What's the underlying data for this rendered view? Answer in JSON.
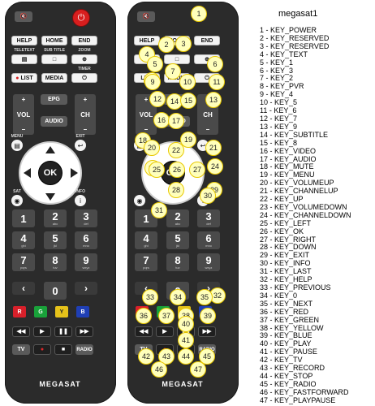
{
  "remote_labels": {
    "help": "HELP",
    "home": "HOME",
    "end": "END",
    "teletext": "TELETEXT",
    "subtitle": "SUB TITLE",
    "zoom": "ZOOM",
    "list": "LIST",
    "media": "MEDIA",
    "timer": "TIMER",
    "vol": "VOL",
    "ch": "CH",
    "epg": "EPG",
    "audio": "AUDIO",
    "menu": "MENU",
    "exit": "EXIT",
    "ok": "OK",
    "sat": "SAT",
    "info": "INFO",
    "tv": "TV",
    "radio": "RADIO",
    "brand": "MEGASAT",
    "plus": "+",
    "minus": "–"
  },
  "number_keys": [
    {
      "digit": "1",
      "letters": ""
    },
    {
      "digit": "2",
      "letters": "abc"
    },
    {
      "digit": "3",
      "letters": "def"
    },
    {
      "digit": "4",
      "letters": "ghi"
    },
    {
      "digit": "5",
      "letters": "jkl"
    },
    {
      "digit": "6",
      "letters": "mno"
    },
    {
      "digit": "7",
      "letters": "pqrs"
    },
    {
      "digit": "8",
      "letters": "tuv"
    },
    {
      "digit": "9",
      "letters": "wxyz"
    },
    {
      "digit": "0",
      "letters": ""
    }
  ],
  "color_keys": [
    {
      "letter": "R",
      "color": "#d8202a"
    },
    {
      "letter": "G",
      "color": "#19a23a"
    },
    {
      "letter": "Y",
      "color": "#e6c21a"
    },
    {
      "letter": "B",
      "color": "#1f3fb5"
    }
  ],
  "marker_numbers": [
    "1",
    "2",
    "3",
    "4",
    "5",
    "6",
    "7",
    "8",
    "9",
    "10",
    "11",
    "12",
    "13",
    "14",
    "15",
    "16",
    "17",
    "18",
    "19",
    "20",
    "21",
    "22",
    "23",
    "24",
    "25",
    "26",
    "27",
    "28",
    "29",
    "30",
    "31",
    "32",
    "33",
    "34",
    "35",
    "36",
    "37",
    "38",
    "39",
    "40",
    "41",
    "42",
    "43",
    "44",
    "45",
    "46",
    "47"
  ],
  "legend": {
    "title": "megasat1",
    "items": [
      "1 - KEY_POWER",
      "2 - KEY_RESERVED",
      "3 - KEY_RESERVED",
      "4 - KEY_TEXT",
      "5 - KEY_1",
      "6 - KEY_3",
      "7 - KEY_2",
      "8 - KEY_PVR",
      "9 - KEY_4",
      "10 - KEY_5",
      "11 - KEY_6",
      "12 - KEY_7",
      "13 - KEY_9",
      "14 - KEY_SUBTITLE",
      "15 - KEY_8",
      "16 - KEY_VIDEO",
      "17 - KEY_AUDIO",
      "18 - KEY_MUTE",
      "19 - KEY_MENU",
      "20 - KEY_VOLUMEUP",
      "21 - KEY_CHANNELUP",
      "22 - KEY_UP",
      "23 - KEY_VOLUMEDOWN",
      "24 - KEY_CHANNELDOWN",
      "25 - KEY_LEFT",
      "26 - KEY_OK",
      "27 - KEY_RIGHT",
      "28 - KEY_DOWN",
      "29 - KEY_EXIT",
      "30 - KEY_INFO",
      "31 - KEY_LAST",
      "32 - KEY_HELP",
      "33 - KEY_PREVIOUS",
      "34 - KEY_0",
      "35 - KEY_NEXT",
      "36 - KEY_RED",
      "37 - KEY_GREEN",
      "38 - KEY_YELLOW",
      "39 - KEY_BLUE",
      "40 - KEY_PLAY",
      "41 - KEY_PAUSE",
      "42 - KEY_TV",
      "43 - KEY_RECORD",
      "44 - KEY_STOP",
      "45 - KEY_RADIO",
      "46 - KEY_FASTFORWARD",
      "47 - KEY_PLAYPAUSE"
    ]
  }
}
